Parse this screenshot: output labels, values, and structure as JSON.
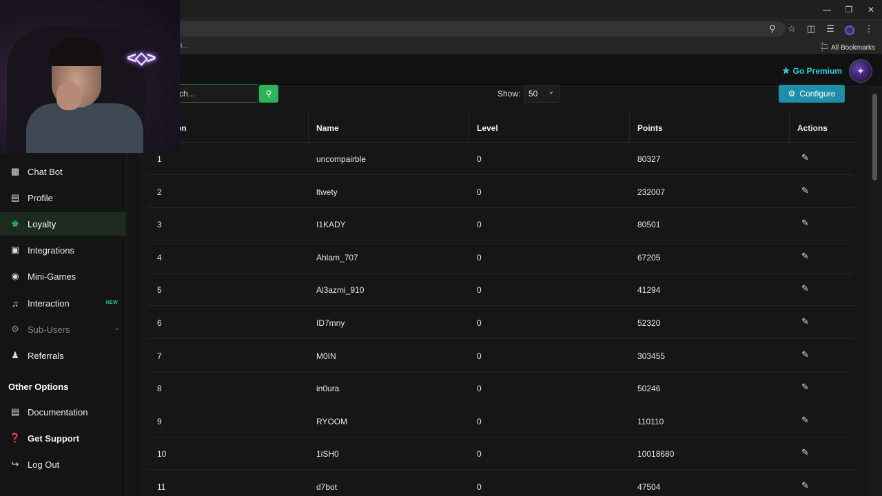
{
  "browser": {
    "bookmark_left": "i...",
    "all_bookmarks": "All Bookmarks",
    "icons": [
      "zoom-icon",
      "star-icon",
      "extensions-icon",
      "media-icon",
      "profile-icon",
      "menu-icon"
    ]
  },
  "header": {
    "go_premium": "Go Premium"
  },
  "sidebar": {
    "items": [
      {
        "label": "Chat Bot",
        "icon": "robot-icon"
      },
      {
        "label": "Profile",
        "icon": "id-card-icon"
      },
      {
        "label": "Loyalty",
        "icon": "trophy-icon",
        "active": true
      },
      {
        "label": "Integrations",
        "icon": "discord-icon"
      },
      {
        "label": "Mini-Games",
        "icon": "gamepad-icon"
      },
      {
        "label": "Interaction",
        "icon": "music-icon",
        "badge": "NEW"
      },
      {
        "label": "Sub-Users",
        "icon": "users-cog-icon",
        "disabled": true
      },
      {
        "label": "Referrals",
        "icon": "user-friends-icon"
      }
    ],
    "other_options_title": "Other Options",
    "other_items": [
      {
        "label": "Documentation",
        "icon": "scroll-icon"
      },
      {
        "label": "Get Support",
        "icon": "question-circle-icon"
      },
      {
        "label": "Log Out",
        "icon": "sign-out-icon"
      }
    ]
  },
  "toolbar": {
    "search_value": "ch...",
    "show_label": "Show:",
    "show_value": "50",
    "configure_label": "Configure"
  },
  "table": {
    "columns": [
      "on",
      "Name",
      "Level",
      "Points",
      "Actions"
    ],
    "rows": [
      {
        "rank": "1",
        "name": "uncompairble",
        "level": "0",
        "points": "80327"
      },
      {
        "rank": "2",
        "name": "ltwety",
        "level": "0",
        "points": "232007"
      },
      {
        "rank": "3",
        "name": "I1KADY",
        "level": "0",
        "points": "80501"
      },
      {
        "rank": "4",
        "name": "Ahlam_707",
        "level": "0",
        "points": "67205"
      },
      {
        "rank": "5",
        "name": "Al3azmi_910",
        "level": "0",
        "points": "41294"
      },
      {
        "rank": "6",
        "name": "ID7mny",
        "level": "0",
        "points": "52320"
      },
      {
        "rank": "7",
        "name": "M0IN",
        "level": "0",
        "points": "303455"
      },
      {
        "rank": "8",
        "name": "in0ura",
        "level": "0",
        "points": "50246"
      },
      {
        "rank": "9",
        "name": "RYOOM",
        "level": "0",
        "points": "110110"
      },
      {
        "rank": "10",
        "name": "1iSH0",
        "level": "0",
        "points": "10018680"
      },
      {
        "rank": "11",
        "name": "d7bot",
        "level": "0",
        "points": "47504"
      }
    ]
  },
  "colors": {
    "accent_green": "#2fb357",
    "premium_cyan": "#34d1df",
    "configure_blue": "#1f8ea6"
  }
}
